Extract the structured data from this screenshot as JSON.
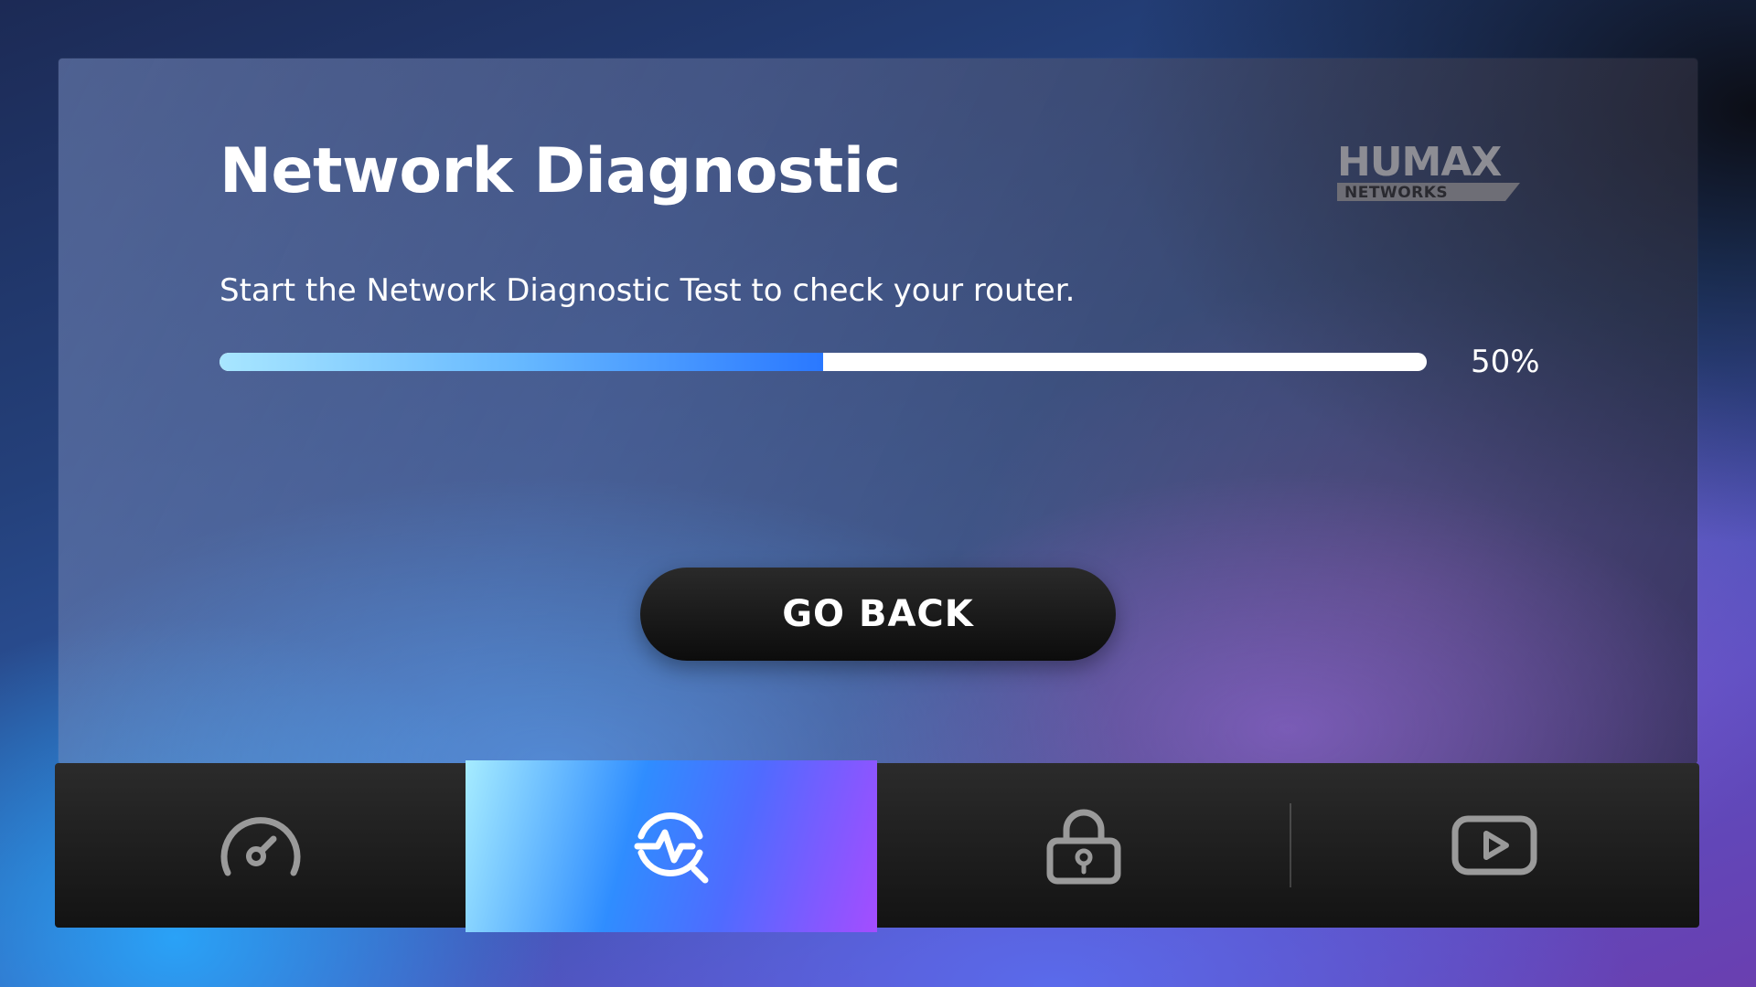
{
  "page": {
    "title": "Network Diagnostic",
    "subtitle": "Start the Network Diagnostic Test to check your router."
  },
  "logo": {
    "brand": "HUMAX",
    "tagline": "NETWORKS"
  },
  "progress": {
    "value": 0.5,
    "label": "50%"
  },
  "actions": {
    "go_back_label": "GO BACK"
  },
  "nav": {
    "items": [
      {
        "icon": "speedometer-icon",
        "active": false
      },
      {
        "icon": "network-diagnostic-icon",
        "active": true
      },
      {
        "icon": "lock-icon",
        "active": false
      },
      {
        "icon": "play-video-icon",
        "active": false
      }
    ]
  },
  "colors": {
    "progress_start": "#a8e6ff",
    "progress_end": "#2a78ff",
    "active_tab_start": "#a6ecff",
    "active_tab_end": "#a44dff",
    "button_bg": "#0c0c0c"
  }
}
